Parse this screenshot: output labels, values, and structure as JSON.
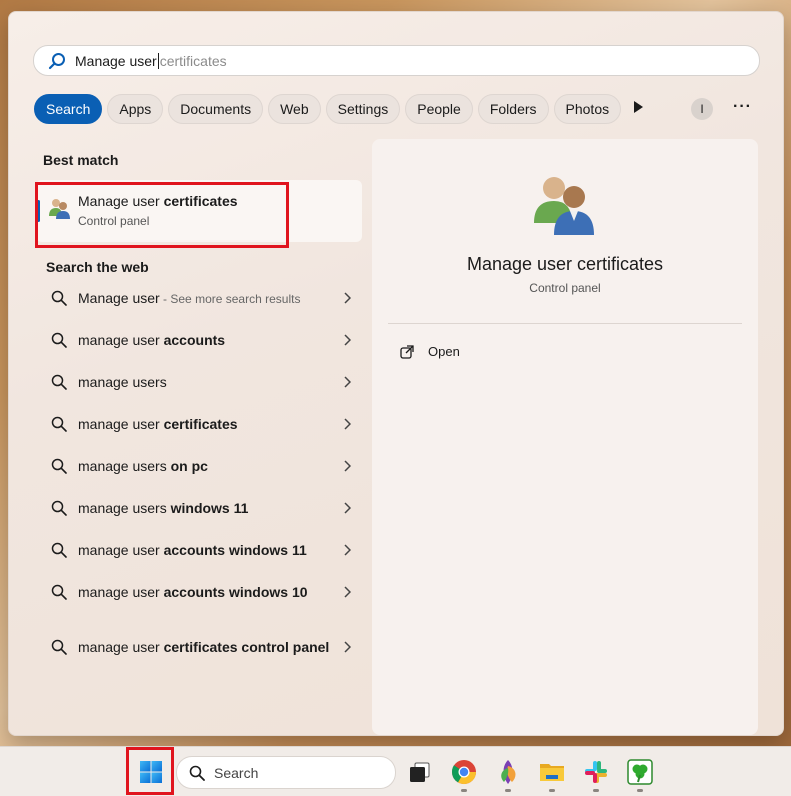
{
  "search": {
    "typed": "Manage user",
    "suggestion": "certificates"
  },
  "filters": [
    "Search",
    "Apps",
    "Documents",
    "Web",
    "Settings",
    "People",
    "Folders",
    "Photos"
  ],
  "account_initial": "I",
  "more_label": "···",
  "best_match": {
    "heading": "Best match",
    "title_normal": "Manage user ",
    "title_bold": "certificates",
    "subtitle": "Control panel"
  },
  "web": {
    "heading": "Search the web",
    "items": [
      {
        "prefix": "Manage user",
        "bold": "",
        "muted": " - See more search results"
      },
      {
        "prefix": "manage user ",
        "bold": "accounts",
        "muted": ""
      },
      {
        "prefix": "manage users",
        "bold": "",
        "muted": ""
      },
      {
        "prefix": "manage user ",
        "bold": "certificates",
        "muted": ""
      },
      {
        "prefix": "manage users ",
        "bold": "on pc",
        "muted": ""
      },
      {
        "prefix": "manage users ",
        "bold": "windows 11",
        "muted": ""
      },
      {
        "prefix": "manage user ",
        "bold": "accounts windows 11",
        "muted": ""
      },
      {
        "prefix": "manage user ",
        "bold": "accounts windows 10",
        "muted": ""
      },
      {
        "prefix": "manage user ",
        "bold": "certificates control panel",
        "muted": ""
      }
    ]
  },
  "preview": {
    "title": "Manage user certificates",
    "subtitle": "Control panel",
    "open_label": "Open"
  },
  "taskbar": {
    "search_placeholder": "Search"
  },
  "colors": {
    "accent": "#0a5fb4",
    "highlight_box": "#e0141e"
  }
}
